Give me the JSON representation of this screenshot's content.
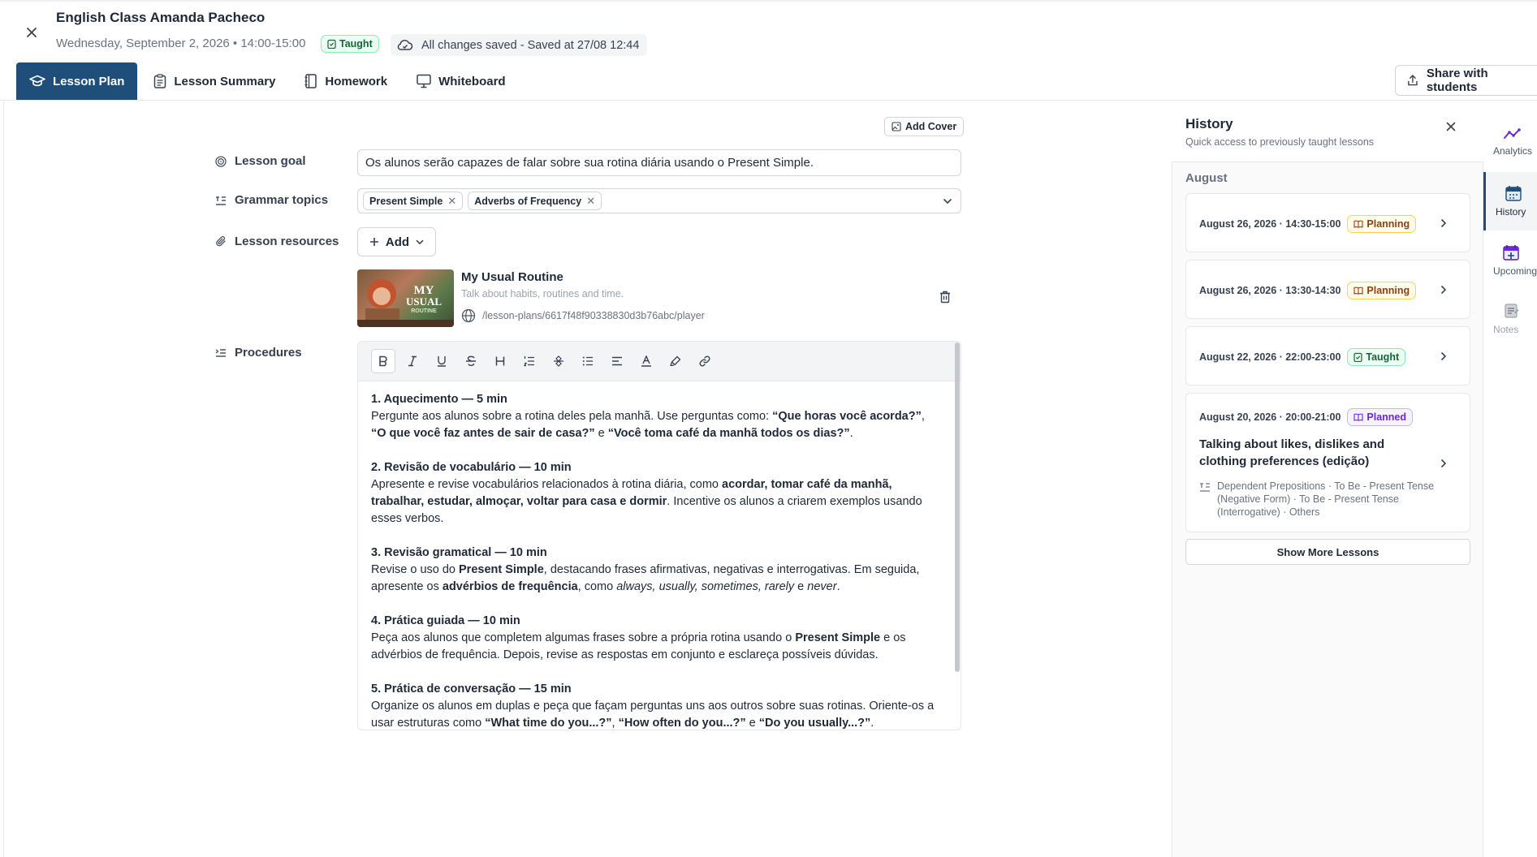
{
  "header": {
    "title": "English Class Amanda Pacheco",
    "datetime": "Wednesday, September 2, 2026 • 14:00-15:00",
    "status_badge": "Taught",
    "save_status": "All changes saved - Saved at 27/08 12:44",
    "share_label": "Share with students"
  },
  "tabs": [
    {
      "label": "Lesson Plan",
      "icon": "graduation-cap-icon",
      "active": true
    },
    {
      "label": "Lesson Summary",
      "icon": "clipboard-icon",
      "active": false
    },
    {
      "label": "Homework",
      "icon": "notebook-icon",
      "active": false
    },
    {
      "label": "Whiteboard",
      "icon": "presentation-icon",
      "active": false
    }
  ],
  "lesson": {
    "add_cover_label": "Add Cover",
    "goal_label": "Lesson goal",
    "goal_value": "Os alunos serão capazes de falar sobre sua rotina diária usando o Present Simple.",
    "grammar_label": "Grammar topics",
    "grammar_topics": [
      "Present Simple",
      "Adverbs of Frequency"
    ],
    "resources_label": "Lesson resources",
    "add_label": "Add",
    "resource": {
      "title": "My Usual Routine",
      "description": "Talk about habits, routines and time.",
      "link": "/lesson-plans/6617f48f90338830d3b76abc/player",
      "thumb_text": [
        "MY",
        "USUAL",
        "ROUTINE"
      ]
    },
    "procedures_label": "Procedures"
  },
  "procedures": [
    {
      "heading": "1. Aquecimento — 5 min",
      "body": [
        {
          "t": "Pergunte aos alunos sobre a rotina deles pela manhã. Use perguntas como: "
        },
        {
          "t": "“Que horas você acorda?”",
          "b": true
        },
        {
          "t": ", "
        },
        {
          "t": "“O que você faz antes de sair de casa?”",
          "b": true
        },
        {
          "t": " e "
        },
        {
          "t": "“Você toma café da manhã todos os dias?”",
          "b": true
        },
        {
          "t": "."
        }
      ]
    },
    {
      "heading": "2. Revisão de vocabulário — 10 min",
      "body": [
        {
          "t": "Apresente e revise vocabulários relacionados à rotina diária, como "
        },
        {
          "t": "acordar, tomar café da manhã, trabalhar, estudar, almoçar, voltar para casa e dormir",
          "b": true
        },
        {
          "t": ". Incentive os alunos a criarem exemplos usando esses verbos."
        }
      ]
    },
    {
      "heading": "3. Revisão gramatical — 10 min",
      "body": [
        {
          "t": "Revise o uso do "
        },
        {
          "t": "Present Simple",
          "b": true
        },
        {
          "t": ", destacando frases afirmativas, negativas e interrogativas. Em seguida, apresente os "
        },
        {
          "t": "advérbios de frequência",
          "b": true
        },
        {
          "t": ", como "
        },
        {
          "t": "always, usually, sometimes, rarely",
          "i": true
        },
        {
          "t": " e "
        },
        {
          "t": "never",
          "i": true
        },
        {
          "t": "."
        }
      ]
    },
    {
      "heading": "4. Prática guiada — 10 min",
      "body": [
        {
          "t": "Peça aos alunos que completem algumas frases sobre a própria rotina usando o "
        },
        {
          "t": "Present Simple",
          "b": true
        },
        {
          "t": " e os advérbios de frequência. Depois, revise as respostas em conjunto e esclareça possíveis dúvidas."
        }
      ]
    },
    {
      "heading": "5. Prática de conversação — 15 min",
      "body": [
        {
          "t": "Organize os alunos em duplas e peça que façam perguntas uns aos outros sobre suas rotinas. Oriente-os a usar estruturas como "
        },
        {
          "t": "“What time do you...?”",
          "b": true
        },
        {
          "t": ", "
        },
        {
          "t": "“How often do you...?”",
          "b": true
        },
        {
          "t": " e "
        },
        {
          "t": "“Do you usually...?”",
          "b": true
        },
        {
          "t": "."
        }
      ]
    }
  ],
  "toolbar": [
    "bold-icon",
    "italic-icon",
    "underline-icon",
    "strikethrough-icon",
    "heading-icon",
    "ordered-list-icon",
    "horizontal-rule-icon",
    "bullet-list-icon",
    "align-icon",
    "text-color-icon",
    "highlight-icon",
    "link-icon"
  ],
  "history": {
    "title": "History",
    "subtitle": "Quick access to previously taught lessons",
    "month": "August",
    "cards": [
      {
        "date": "August 26, 2026 · 14:30-15:00",
        "status": "Planning"
      },
      {
        "date": "August 26, 2026 · 13:30-14:30",
        "status": "Planning"
      },
      {
        "date": "August 22, 2026 · 22:00-23:00",
        "status": "Taught"
      },
      {
        "date": "August 20, 2026 · 20:00-21:00",
        "status": "Planned",
        "title": "Talking about likes, dislikes and clothing preferences (edição)",
        "tags": "Dependent Prepositions · To Be - Present Tense (Negative Form) · To Be - Present Tense (Interrogative) · Others"
      }
    ],
    "show_more": "Show More Lessons"
  },
  "rail": [
    {
      "label": "Analytics",
      "icon": "analytics-icon",
      "active": false
    },
    {
      "label": "History",
      "icon": "calendar-icon",
      "active": true
    },
    {
      "label": "Upcoming",
      "icon": "calendar-upcoming-icon",
      "active": false
    },
    {
      "label": "Notes",
      "icon": "notes-icon",
      "active": false
    }
  ],
  "colors": {
    "primary": "#1e4e79",
    "taught": "#166534",
    "planning": "#92400e",
    "planned": "#6d28d9"
  }
}
